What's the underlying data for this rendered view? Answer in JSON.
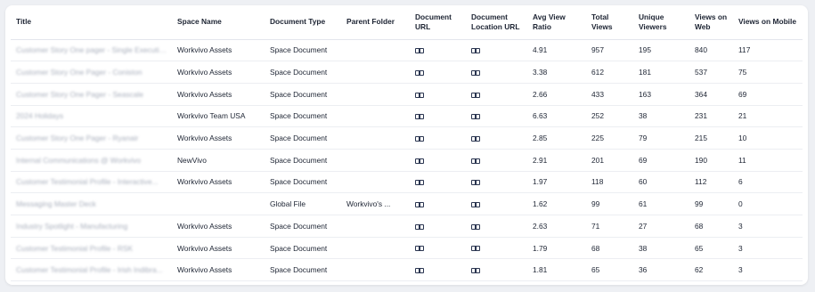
{
  "headers": [
    "Title",
    "Space Name",
    "Document Type",
    "Parent Folder",
    "Document URL",
    "Document Location URL",
    "Avg View Ratio",
    "Total Views",
    "Unique Viewers",
    "Views on Web",
    "Views on Mobile"
  ],
  "rows": [
    {
      "title": "Customer Story One pager - Single Execution",
      "space": "Workvivo Assets",
      "doc_type": "Space Document",
      "parent": "",
      "avg": "4.91",
      "total": "957",
      "unique": "195",
      "web": "840",
      "mobile": "117"
    },
    {
      "title": "Customer Story One Pager - Coniston",
      "space": "Workvivo Assets",
      "doc_type": "Space Document",
      "parent": "",
      "avg": "3.38",
      "total": "612",
      "unique": "181",
      "web": "537",
      "mobile": "75"
    },
    {
      "title": "Customer Story One Pager - Seascale",
      "space": "Workvivo Assets",
      "doc_type": "Space Document",
      "parent": "",
      "avg": "2.66",
      "total": "433",
      "unique": "163",
      "web": "364",
      "mobile": "69"
    },
    {
      "title": "2024 Holidays",
      "space": "Workvivo Team USA",
      "doc_type": "Space Document",
      "parent": "",
      "avg": "6.63",
      "total": "252",
      "unique": "38",
      "web": "231",
      "mobile": "21"
    },
    {
      "title": "Customer Story One Pager - Ryanair",
      "space": "Workvivo Assets",
      "doc_type": "Space Document",
      "parent": "",
      "avg": "2.85",
      "total": "225",
      "unique": "79",
      "web": "215",
      "mobile": "10"
    },
    {
      "title": "Internal Communications @ Workvivo",
      "space": "NewVivo",
      "doc_type": "Space Document",
      "parent": "",
      "avg": "2.91",
      "total": "201",
      "unique": "69",
      "web": "190",
      "mobile": "11"
    },
    {
      "title": "Customer Testimonial Profile - Interactive...",
      "space": "Workvivo Assets",
      "doc_type": "Space Document",
      "parent": "",
      "avg": "1.97",
      "total": "118",
      "unique": "60",
      "web": "112",
      "mobile": "6"
    },
    {
      "title": "Messaging Master Deck",
      "space": "",
      "doc_type": "Global File",
      "parent": "Workvivo's ...",
      "avg": "1.62",
      "total": "99",
      "unique": "61",
      "web": "99",
      "mobile": "0"
    },
    {
      "title": "Industry Spotlight - Manufacturing",
      "space": "Workvivo Assets",
      "doc_type": "Space Document",
      "parent": "",
      "avg": "2.63",
      "total": "71",
      "unique": "27",
      "web": "68",
      "mobile": "3"
    },
    {
      "title": "Customer Testimonial Profile - RSK",
      "space": "Workvivo Assets",
      "doc_type": "Space Document",
      "parent": "",
      "avg": "1.79",
      "total": "68",
      "unique": "38",
      "web": "65",
      "mobile": "3"
    },
    {
      "title": "Customer Testimonial Profile - Irish Indibra...",
      "space": "Workvivo Assets",
      "doc_type": "Space Document",
      "parent": "",
      "avg": "1.81",
      "total": "65",
      "unique": "36",
      "web": "62",
      "mobile": "3"
    }
  ],
  "icons": {
    "document_url": "link-icon",
    "location_url": "link-icon"
  }
}
